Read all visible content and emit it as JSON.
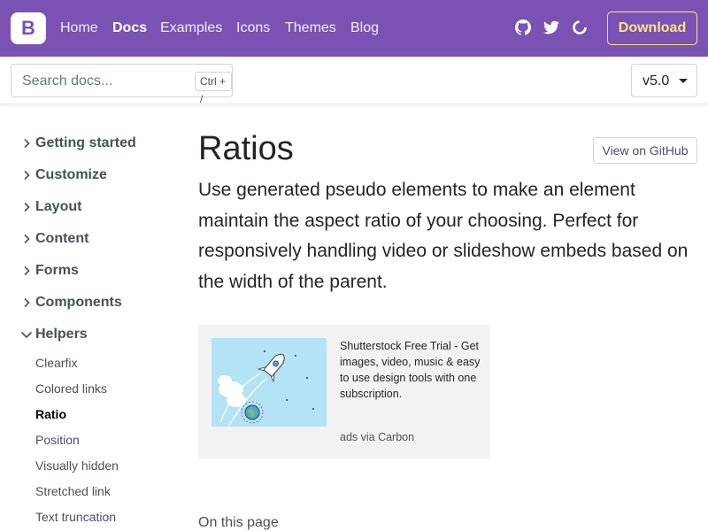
{
  "navbar": {
    "brand_letter": "B",
    "links": [
      {
        "label": "Home",
        "active": false
      },
      {
        "label": "Docs",
        "active": true
      },
      {
        "label": "Examples",
        "active": false
      },
      {
        "label": "Icons",
        "active": false
      },
      {
        "label": "Themes",
        "active": false
      },
      {
        "label": "Blog",
        "active": false
      }
    ],
    "icons": [
      "github-icon",
      "twitter-icon",
      "opencollective-icon"
    ],
    "download_label": "Download",
    "colors": {
      "background": "#7952b3",
      "download": "#ffe484"
    }
  },
  "subnav": {
    "search_placeholder": "Search docs...",
    "search_shortcut": "Ctrl + /",
    "version": "v5.0"
  },
  "sidebar": {
    "sections": [
      {
        "label": "Getting started",
        "expanded": false
      },
      {
        "label": "Customize",
        "expanded": false
      },
      {
        "label": "Layout",
        "expanded": false
      },
      {
        "label": "Content",
        "expanded": false
      },
      {
        "label": "Forms",
        "expanded": false
      },
      {
        "label": "Components",
        "expanded": false
      },
      {
        "label": "Helpers",
        "expanded": true
      }
    ],
    "helpers_items": [
      {
        "label": "Clearfix",
        "active": false
      },
      {
        "label": "Colored links",
        "active": false
      },
      {
        "label": "Ratio",
        "active": true
      },
      {
        "label": "Position",
        "active": false
      },
      {
        "label": "Visually hidden",
        "active": false
      },
      {
        "label": "Stretched link",
        "active": false
      },
      {
        "label": "Text truncation",
        "active": false
      }
    ]
  },
  "main": {
    "title": "Ratios",
    "github_button": "View on GitHub",
    "lead": "Use generated pseudo elements to make an element maintain the aspect ratio of your choosing. Perfect for responsively handling video or slideshow embeds based on the width of the parent.",
    "ad": {
      "text": "Shutterstock Free Trial - Get images, video, music & easy to use design tools with one subscription.",
      "via": "ads via Carbon"
    },
    "on_this_page": "On this page"
  }
}
